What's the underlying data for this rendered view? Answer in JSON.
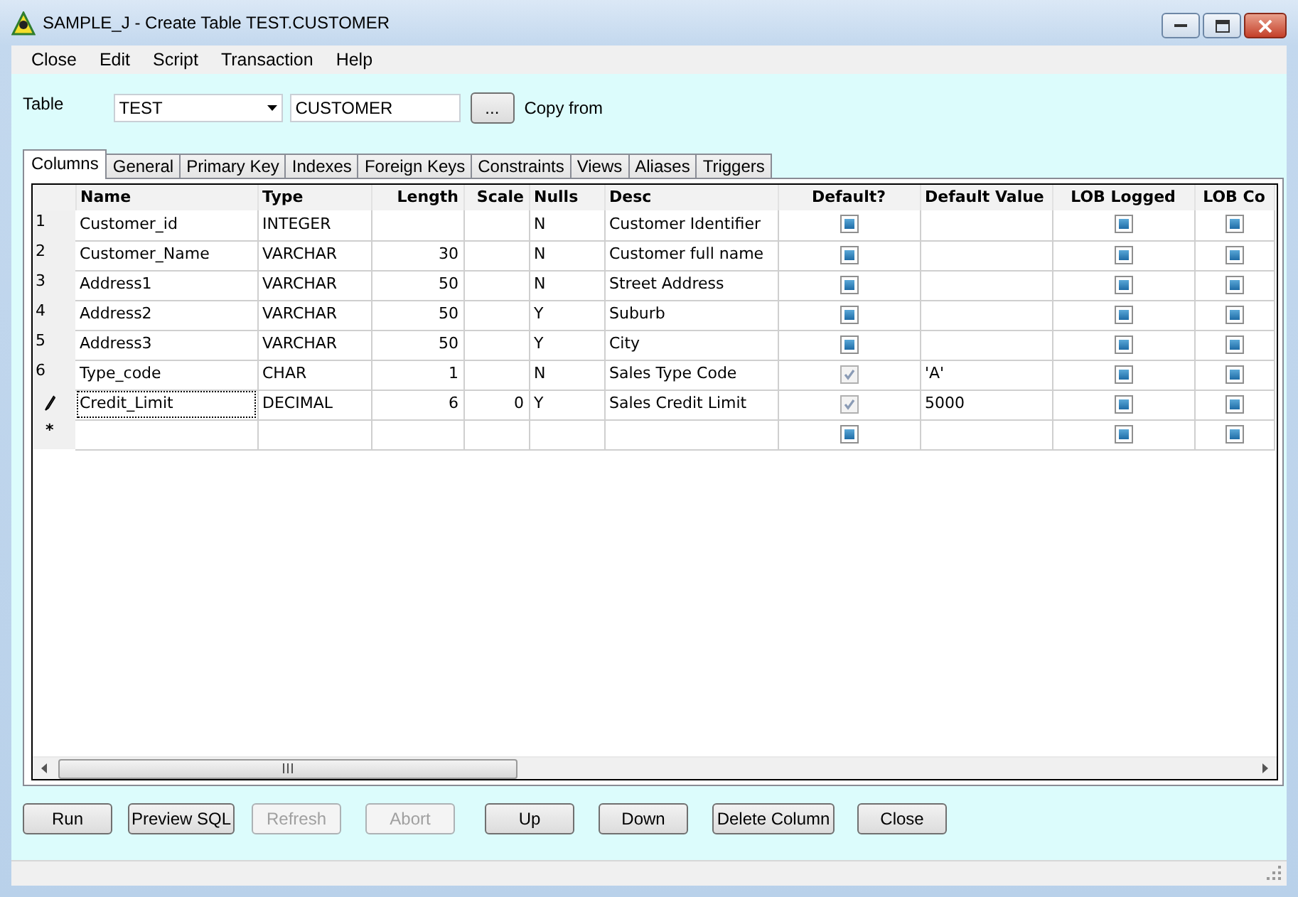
{
  "window": {
    "title": "SAMPLE_J - Create Table TEST.CUSTOMER"
  },
  "menu": [
    {
      "label": "Close"
    },
    {
      "label": "Edit"
    },
    {
      "label": "Script"
    },
    {
      "label": "Transaction"
    },
    {
      "label": "Help"
    }
  ],
  "table_selector": {
    "label": "Table",
    "schema": "TEST",
    "table": "CUSTOMER",
    "browse_button": "...",
    "copy_label": "Copy from"
  },
  "tabs": [
    {
      "label": "Columns",
      "selected": true
    },
    {
      "label": "General",
      "selected": false
    },
    {
      "label": "Primary Key",
      "selected": false
    },
    {
      "label": "Indexes",
      "selected": false
    },
    {
      "label": "Foreign Keys",
      "selected": false
    },
    {
      "label": "Constraints",
      "selected": false
    },
    {
      "label": "Views",
      "selected": false
    },
    {
      "label": "Aliases",
      "selected": false
    },
    {
      "label": "Triggers",
      "selected": false
    }
  ],
  "grid": {
    "columns": [
      {
        "label": "Name",
        "kind": "text"
      },
      {
        "label": "Type",
        "kind": "text"
      },
      {
        "label": "Length",
        "kind": "number"
      },
      {
        "label": "Scale",
        "kind": "number"
      },
      {
        "label": "Nulls",
        "kind": "text"
      },
      {
        "label": "Desc",
        "kind": "text"
      },
      {
        "label": "Default?",
        "kind": "check"
      },
      {
        "label": "Default Value",
        "kind": "text"
      },
      {
        "label": "LOB Logged",
        "kind": "check"
      },
      {
        "label": "LOB Co",
        "kind": "check"
      }
    ],
    "rows": [
      {
        "marker": {
          "kind": "number",
          "text": "1"
        },
        "focused": false,
        "cells": [
          "Customer_id",
          "INTEGER",
          null,
          null,
          "N",
          "Customer Identifier",
          {
            "checked": false
          },
          null,
          {
            "checked": false
          },
          {
            "checked": false
          }
        ]
      },
      {
        "marker": {
          "kind": "number",
          "text": "2"
        },
        "focused": false,
        "cells": [
          "Customer_Name",
          "VARCHAR",
          "30",
          null,
          "N",
          "Customer full name",
          {
            "checked": false
          },
          null,
          {
            "checked": false
          },
          {
            "checked": false
          }
        ]
      },
      {
        "marker": {
          "kind": "number",
          "text": "3"
        },
        "focused": false,
        "cells": [
          "Address1",
          "VARCHAR",
          "50",
          null,
          "N",
          "Street Address",
          {
            "checked": false
          },
          null,
          {
            "checked": false
          },
          {
            "checked": false
          }
        ]
      },
      {
        "marker": {
          "kind": "number",
          "text": "4"
        },
        "focused": false,
        "cells": [
          "Address2",
          "VARCHAR",
          "50",
          null,
          "Y",
          "Suburb",
          {
            "checked": false
          },
          null,
          {
            "checked": false
          },
          {
            "checked": false
          }
        ]
      },
      {
        "marker": {
          "kind": "number",
          "text": "5"
        },
        "focused": false,
        "cells": [
          "Address3",
          "VARCHAR",
          "50",
          null,
          "Y",
          "City",
          {
            "checked": false
          },
          null,
          {
            "checked": false
          },
          {
            "checked": false
          }
        ]
      },
      {
        "marker": {
          "kind": "number",
          "text": "6"
        },
        "focused": false,
        "cells": [
          "Type_code",
          "CHAR",
          "1",
          null,
          "N",
          "Sales Type Code",
          {
            "checked": true
          },
          "'A'",
          {
            "checked": false
          },
          {
            "checked": false
          }
        ]
      },
      {
        "marker": {
          "kind": "editing"
        },
        "focused": true,
        "cells": [
          "Credit_Limit",
          "DECIMAL",
          "6",
          "0",
          "Y",
          "Sales Credit Limit",
          {
            "checked": true
          },
          "5000",
          {
            "checked": false
          },
          {
            "checked": false
          }
        ]
      },
      {
        "marker": {
          "kind": "new",
          "text": "*"
        },
        "focused": false,
        "cells": [
          null,
          null,
          null,
          null,
          null,
          null,
          {
            "checked": false
          },
          null,
          {
            "checked": false
          },
          {
            "checked": false
          }
        ]
      }
    ]
  },
  "buttons": [
    {
      "label": "Run",
      "disabled": false
    },
    {
      "label": "Preview SQL",
      "disabled": false
    },
    {
      "label": "Refresh",
      "disabled": true
    },
    {
      "label": "Abort",
      "disabled": true
    },
    {
      "label": "Up",
      "disabled": false
    },
    {
      "label": "Down",
      "disabled": false
    },
    {
      "label": "Delete Column",
      "disabled": false
    },
    {
      "label": "Close",
      "disabled": false
    }
  ]
}
